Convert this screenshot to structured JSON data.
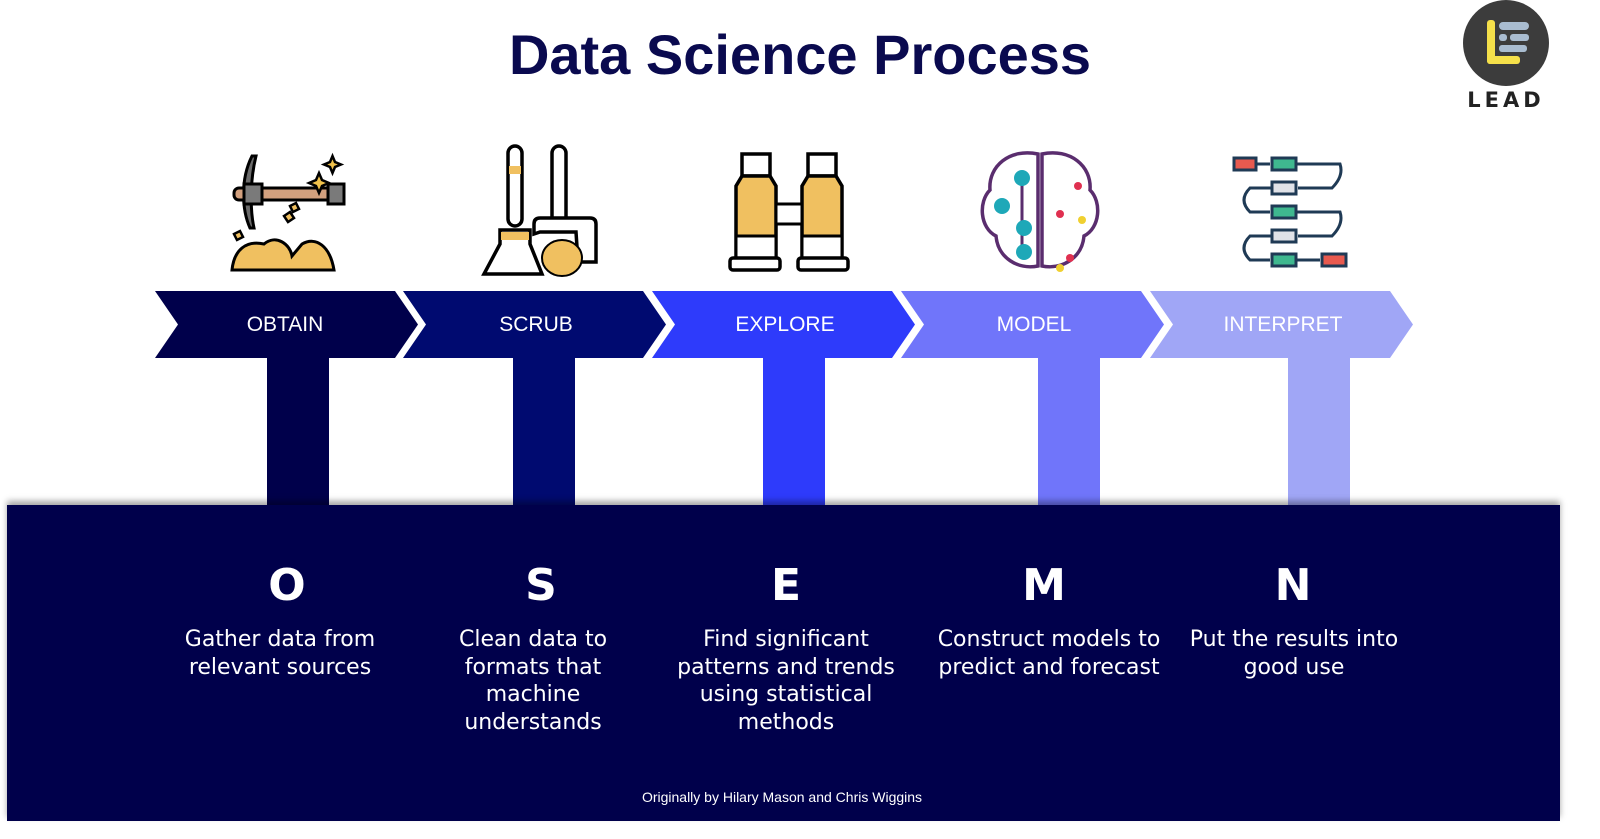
{
  "title": "Data Science Process",
  "logo": {
    "text": "LEAD",
    "icon": "lead-logo-icon"
  },
  "steps": [
    {
      "label": "OBTAIN",
      "letter": "O",
      "description": "Gather data from relevant sources",
      "icon": "pickaxe-icon",
      "color": "#00004b"
    },
    {
      "label": "SCRUB",
      "letter": "S",
      "description": "Clean data to formats that machine understands",
      "icon": "broom-dustpan-icon",
      "color": "#000a70"
    },
    {
      "label": "EXPLORE",
      "letter": "E",
      "description": "Find significant patterns and trends using statistical methods",
      "icon": "binoculars-icon",
      "color": "#2e3bfb"
    },
    {
      "label": "MODEL",
      "letter": "M",
      "description": "Construct models to predict and forecast",
      "icon": "brain-icon",
      "color": "#7075fa"
    },
    {
      "label": "INTERPRET",
      "letter": "N",
      "description": "Put the results into good use",
      "icon": "flowchart-icon",
      "color": "#a0a6f6"
    }
  ],
  "credit": "Originally by Hilary Mason and Chris Wiggins"
}
